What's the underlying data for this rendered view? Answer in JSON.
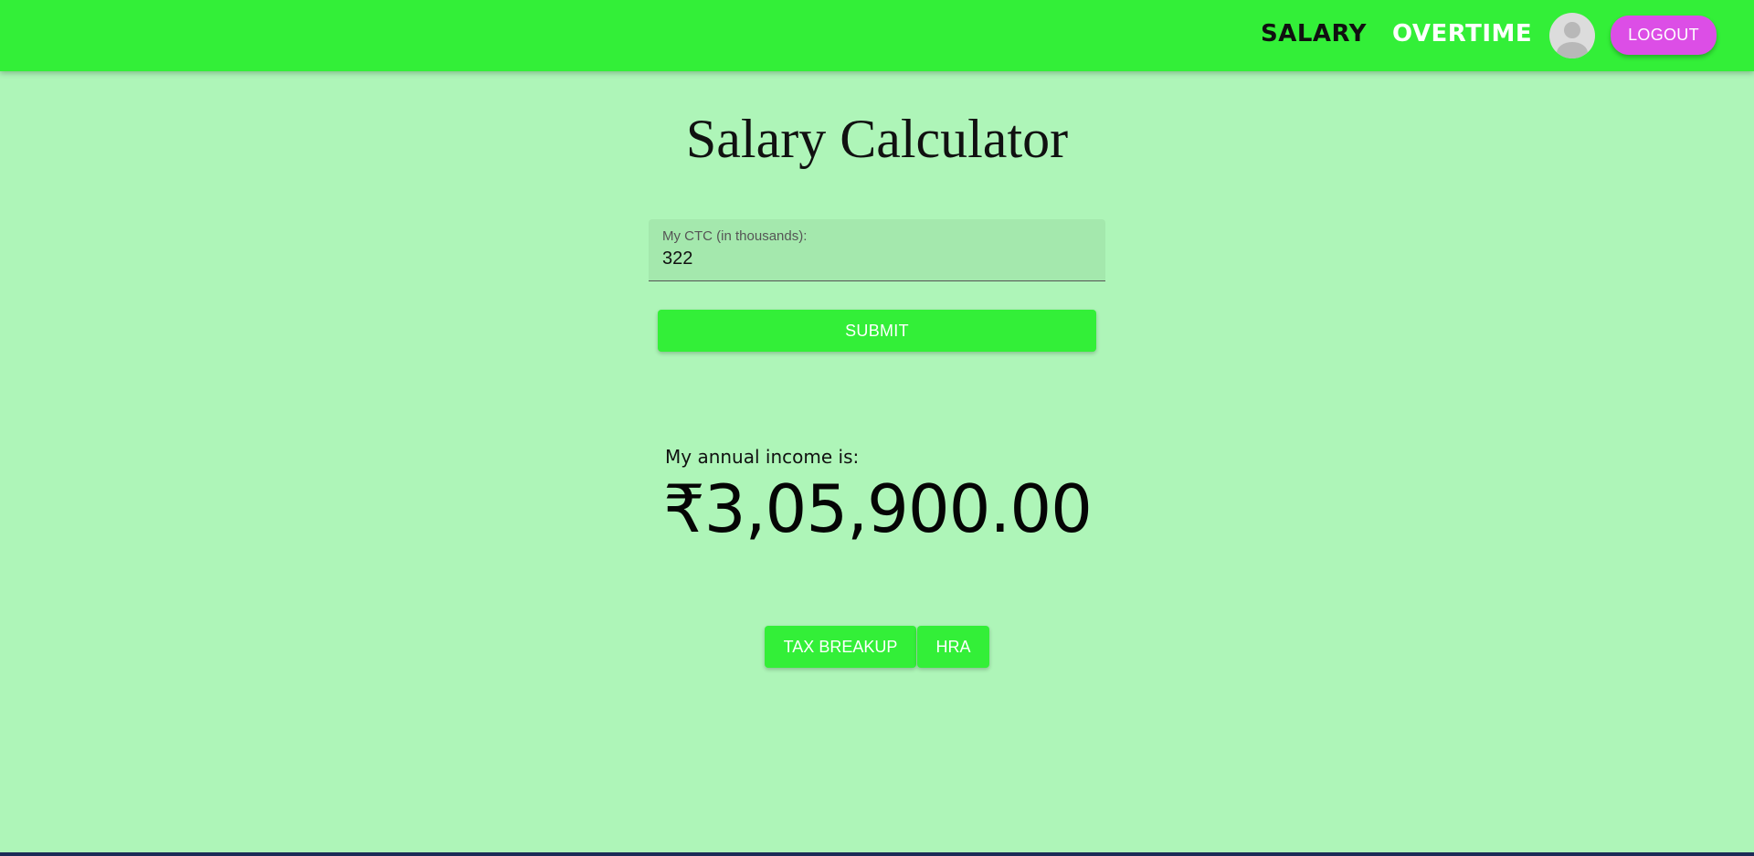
{
  "nav": {
    "salary_label": "SALARY",
    "overtime_label": "OVERTIME",
    "logout_label": "LOGOUT"
  },
  "page": {
    "title": "Salary Calculator"
  },
  "form": {
    "ctc_label": "My CTC (in thousands):",
    "ctc_value": "322",
    "submit_label": "SUBMIT"
  },
  "result": {
    "label": "My annual income is:",
    "value": "₹3,05,900.00"
  },
  "actions": {
    "tax_breakup_label": "TAX BREAKUP",
    "hra_label": "HRA"
  },
  "colors": {
    "topbar": "#33ef38",
    "background": "#aef5b8",
    "logout": "#dc4ee6",
    "button": "#33ef38"
  },
  "icons": {
    "avatar": "user-avatar-icon"
  }
}
